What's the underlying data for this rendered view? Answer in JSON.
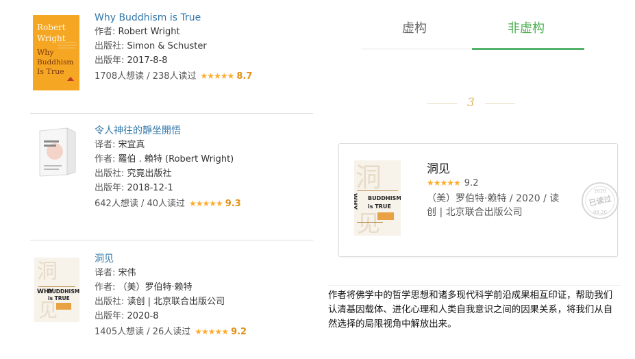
{
  "books": [
    {
      "title": "Why Buddhism is True",
      "translator_label": "",
      "translator": "",
      "author_label": "作者:",
      "author": "Robert Wright",
      "publisher_label": "出版社:",
      "publisher": "Simon & Schuster",
      "year_label": "出版年:",
      "year": "2017-8-8",
      "stats": "1708人想读 / 238人读过",
      "stars": "★★★★★",
      "rating": "8.7",
      "cover_text": [
        "Robert",
        "Wright",
        "Why",
        "Buddhism",
        "Is True"
      ]
    },
    {
      "title": "令人神往的靜坐開悟",
      "translator_label": "译者:",
      "translator": "宋宜真",
      "author_label": "作者:",
      "author": "羅伯 . 賴特 (Robert Wright)",
      "publisher_label": "出版社:",
      "publisher": "究竟出版社",
      "year_label": "出版年:",
      "year": "2018-12-1",
      "stats": "642人想读 / 40人读过",
      "stars": "★★★★★",
      "rating": "9.3"
    },
    {
      "title": "洞见",
      "translator_label": "译者:",
      "translator": "宋伟",
      "author_label": "作者:",
      "author": "（美）罗伯特·赖特",
      "publisher_label": "出版社:",
      "publisher": "读创 | 北京联合出版公司",
      "year_label": "出版年:",
      "year": "2020-8",
      "stats": "1405人想读 / 26人读过",
      "stars": "★★★★★",
      "rating": "9.2"
    }
  ],
  "tabs": [
    "虚构",
    "非虚构"
  ],
  "page_indicator": "3",
  "featured": {
    "title": "洞见",
    "stars": "★★★★★",
    "rating": "9.2",
    "meta": "（美）罗伯特·赖特 / 2020 / 读创 | 北京联合出版公司",
    "cover_text": [
      "洞",
      "WHY",
      "BUDDHISM",
      "is TRUE",
      "见"
    ],
    "stamp_year": "2020",
    "stamp_text": "已读过",
    "stamp_date": "08.20"
  },
  "description": "作者将佛学中的哲学思想和诸多现代科学前沿成果相互印证，帮助我们认清基因载体、进化心理和人类自我意识之间的因果关系，将我们从自然选择的局限视角中解放出来。",
  "colors": {
    "title_link": "#3377aa",
    "star": "#ffac2d",
    "score": "#e09015",
    "tab_active": "#4caf50",
    "page_indicator": "#e4b85e"
  }
}
